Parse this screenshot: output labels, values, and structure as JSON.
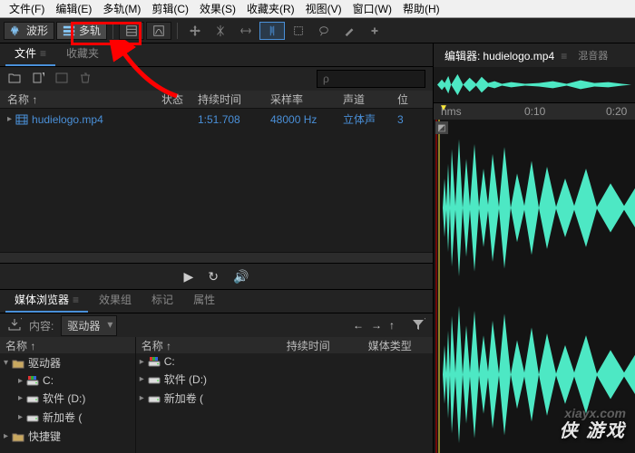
{
  "menubar": [
    "文件(F)",
    "编辑(E)",
    "多轨(M)",
    "剪辑(C)",
    "效果(S)",
    "收藏夹(R)",
    "视图(V)",
    "窗口(W)",
    "帮助(H)"
  ],
  "toolbar": {
    "waveform_label": "波形",
    "multitrack_label": "多轨"
  },
  "files_panel": {
    "tabs": [
      "文件",
      "收藏夹"
    ],
    "search_placeholder": "ρ",
    "columns": [
      "名称 ↑",
      "状态",
      "持续时间",
      "采样率",
      "声道",
      "位"
    ],
    "rows": [
      {
        "name": "hudielogo.mp4",
        "duration": "1:51.708",
        "sample_rate": "48000 Hz",
        "channels": "立体声",
        "bit": "3"
      }
    ]
  },
  "media_browser": {
    "tabs": [
      "媒体浏览器",
      "效果组",
      "标记",
      "属性"
    ],
    "content_label": "内容:",
    "content_value": "驱动器",
    "left_header": "名称 ↑",
    "right_headers": [
      "名称 ↑",
      "持续时间",
      "媒体类型"
    ],
    "left_tree": [
      {
        "label": "驱动器",
        "type": "folder",
        "expandable": true,
        "expanded": true,
        "depth": 0
      },
      {
        "label": "C:",
        "type": "drive-c",
        "expandable": true,
        "expanded": false,
        "depth": 1
      },
      {
        "label": "软件 (D:)",
        "type": "drive",
        "expandable": true,
        "expanded": false,
        "depth": 1
      },
      {
        "label": "新加卷 (",
        "type": "drive",
        "expandable": true,
        "expanded": false,
        "depth": 1
      },
      {
        "label": "快捷键",
        "type": "folder",
        "expandable": true,
        "expanded": false,
        "depth": 0
      }
    ],
    "right_tree": [
      {
        "label": "C:",
        "type": "drive-c",
        "expandable": true,
        "expanded": false
      },
      {
        "label": "软件 (D:)",
        "type": "drive",
        "expandable": true,
        "expanded": false
      },
      {
        "label": "新加卷 (",
        "type": "drive",
        "expandable": true,
        "expanded": false
      }
    ]
  },
  "editor": {
    "tab_prefix": "编辑器:",
    "filename": "hudielogo.mp4",
    "mixer_tab": "混音器",
    "ruler_label": "hms",
    "ticks": [
      "0:10",
      "0:20"
    ]
  },
  "watermarks": {
    "main": "侠 游戏",
    "sub": "xiayx.com"
  }
}
